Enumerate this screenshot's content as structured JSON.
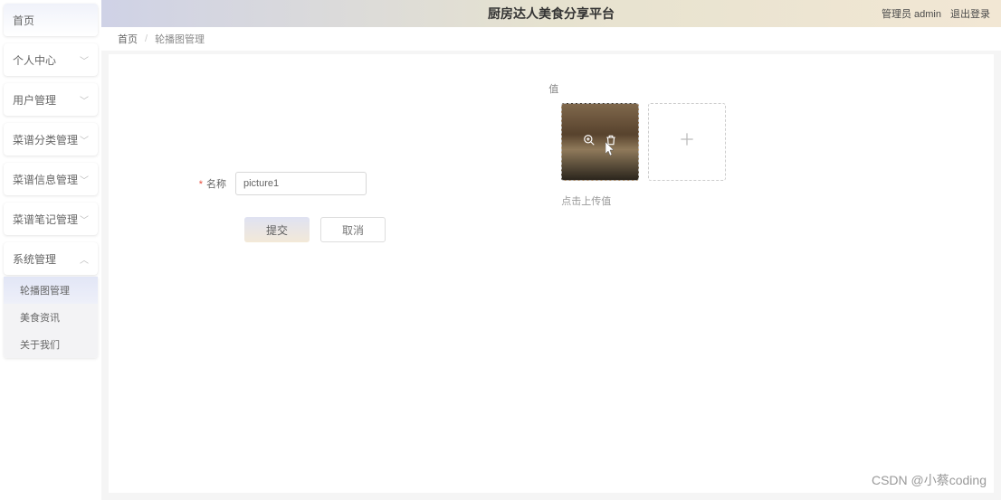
{
  "header": {
    "title": "厨房达人美食分享平台",
    "admin_label": "管理员 admin",
    "logout_label": "退出登录"
  },
  "sidebar": {
    "home": "首页",
    "items": [
      {
        "label": "个人中心"
      },
      {
        "label": "用户管理"
      },
      {
        "label": "菜谱分类管理"
      },
      {
        "label": "菜谱信息管理"
      },
      {
        "label": "菜谱笔记管理"
      },
      {
        "label": "系统管理"
      }
    ],
    "submenu": [
      {
        "label": "轮播图管理",
        "active": true
      },
      {
        "label": "美食资讯"
      },
      {
        "label": "关于我们"
      }
    ]
  },
  "breadcrumb": {
    "home": "首页",
    "current": "轮播图管理"
  },
  "form": {
    "name_label": "名称",
    "name_value": "picture1",
    "submit_label": "提交",
    "cancel_label": "取消"
  },
  "upload": {
    "label": "值",
    "hint": "点击上传值",
    "icons": {
      "zoom": "zoom-in-icon",
      "delete": "trash-icon",
      "add": "plus-icon"
    }
  },
  "watermark": "CSDN @小蔡coding"
}
